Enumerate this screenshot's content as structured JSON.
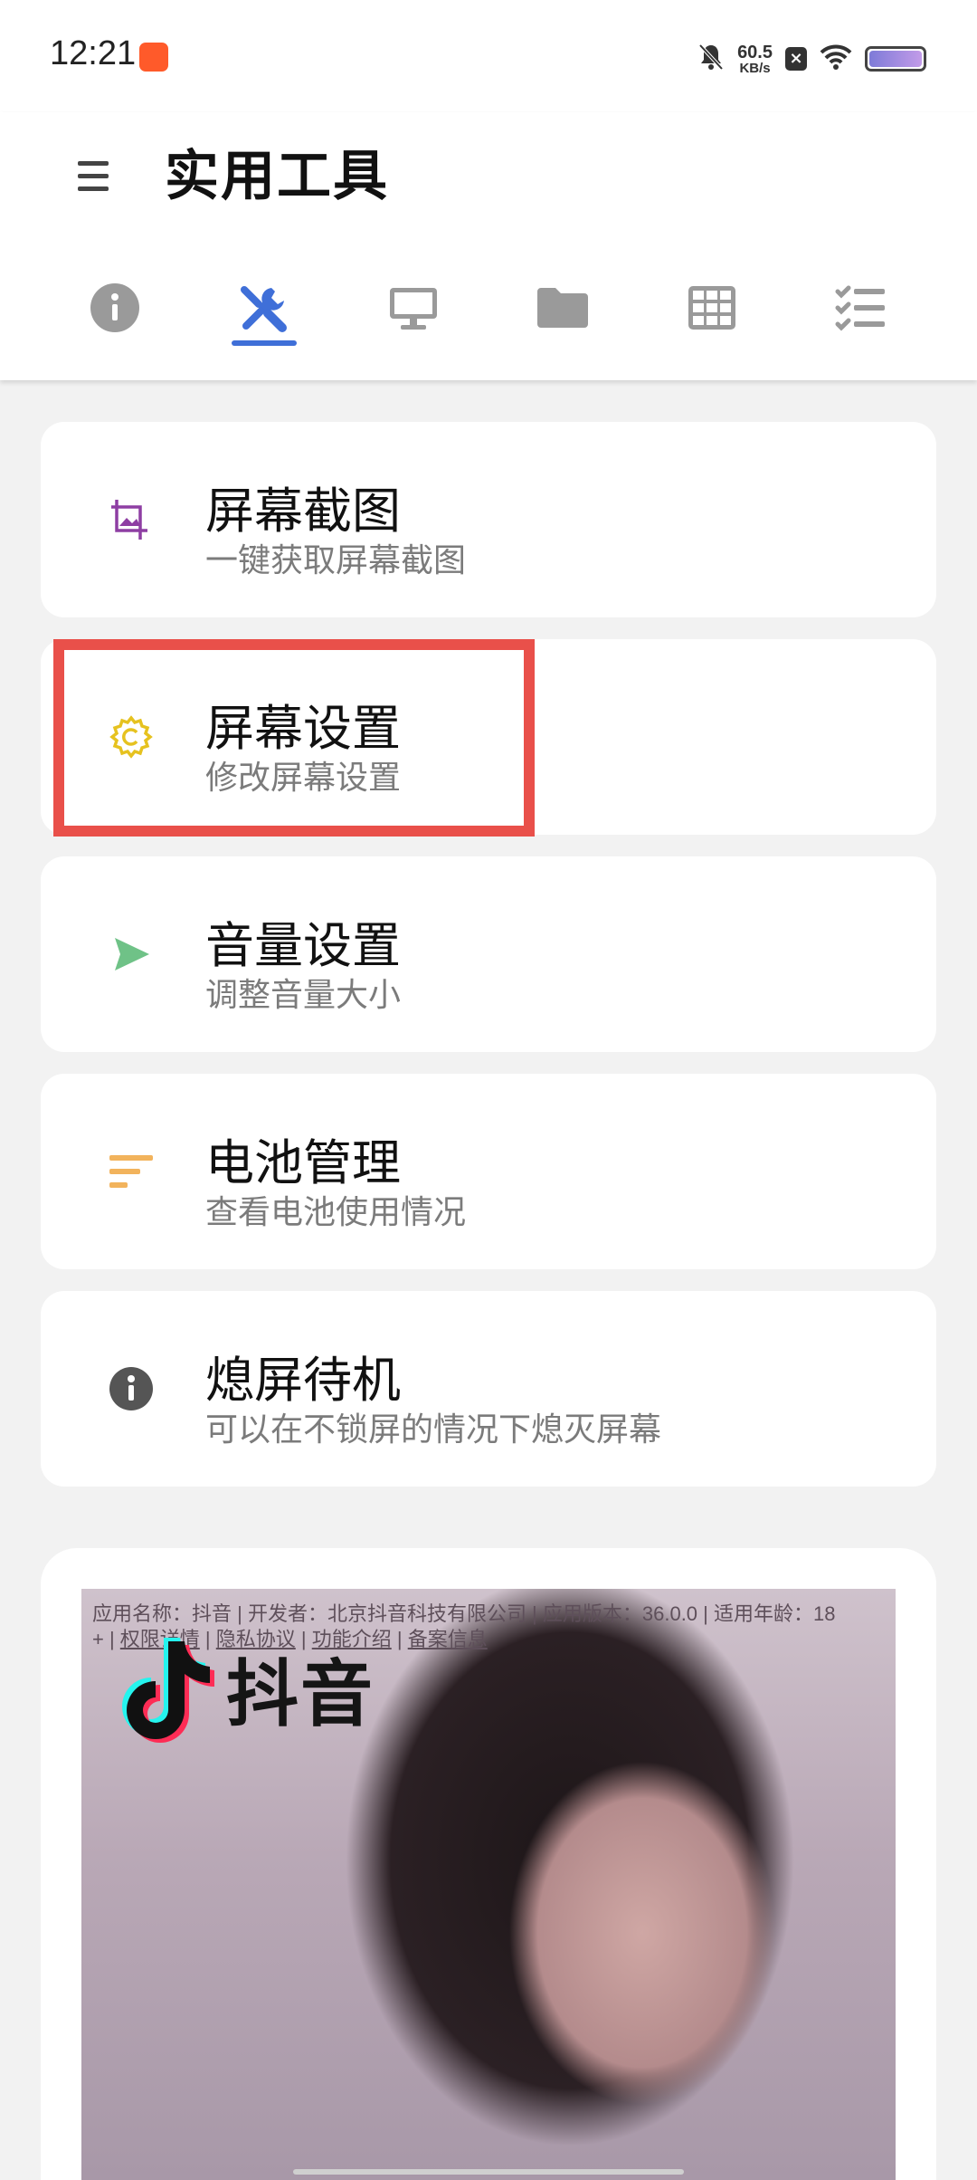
{
  "status_bar": {
    "time": "12:21",
    "net_speed": "60.5",
    "net_unit": "KB/s",
    "xbox_glyph": "×"
  },
  "app_bar": {
    "title": "实用工具",
    "tabs": [
      {
        "name": "info-icon"
      },
      {
        "name": "tools-icon",
        "selected": true
      },
      {
        "name": "monitor-icon"
      },
      {
        "name": "folder-icon"
      },
      {
        "name": "grid-icon"
      },
      {
        "name": "checklist-icon"
      }
    ],
    "accent_color": "#3f6fd8"
  },
  "tools": [
    {
      "title": "屏幕截图",
      "subtitle": "一键获取屏幕截图",
      "icon": "crop-icon",
      "color": "#8e3ea3"
    },
    {
      "title": "屏幕设置",
      "subtitle": "修改屏幕设置",
      "icon": "gear-icon",
      "color": "#e6c21f"
    },
    {
      "title": "音量设置",
      "subtitle": "调整音量大小",
      "icon": "send-icon",
      "color": "#6fc287"
    },
    {
      "title": "电池管理",
      "subtitle": "查看电池使用情况",
      "icon": "sort-icon",
      "color": "#f2b35c"
    },
    {
      "title": "熄屏待机",
      "subtitle": "可以在不锁屏的情况下熄灭屏幕",
      "icon": "info-icon",
      "color": "#555555"
    }
  ],
  "ad": {
    "info_line1": "应用名称：抖音 | 开发者：北京抖音科技有限公司 | 应用版本：36.0.0 | 适用年龄：18",
    "info_line2_prefix": "+ | ",
    "link1": "权限详情",
    "sep": " | ",
    "link2": "隐私协议",
    "link3": "功能介绍",
    "link4": "备案信息",
    "brand": "抖音"
  }
}
